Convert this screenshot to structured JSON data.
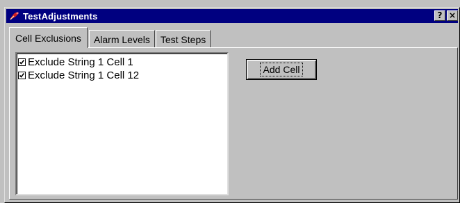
{
  "window": {
    "title": "TestAdjustments",
    "help_button": "?",
    "close_button": "×",
    "app_icon": "app-logo-icon"
  },
  "tabs": [
    {
      "label": "Cell Exclusions",
      "active": true
    },
    {
      "label": "Alarm Levels",
      "active": false
    },
    {
      "label": "Test Steps",
      "active": false
    }
  ],
  "exclusions": {
    "items": [
      {
        "label": "Exclude String 1 Cell 1",
        "checked": true
      },
      {
        "label": "Exclude String 1 Cell 12",
        "checked": true
      }
    ]
  },
  "actions": {
    "add_cell_label": "Add Cell"
  },
  "colors": {
    "titlebar": "#000080",
    "face": "#c0c0c0"
  }
}
